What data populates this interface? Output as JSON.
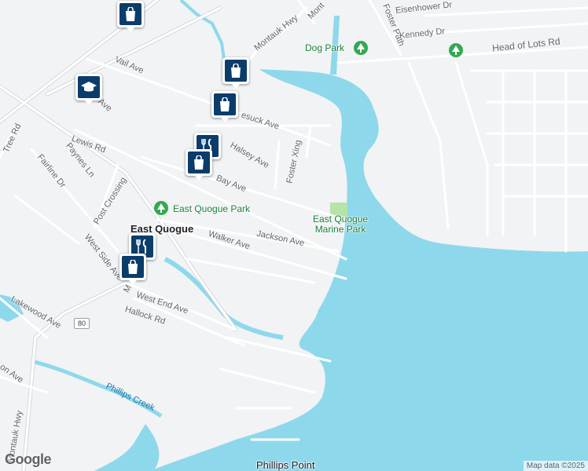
{
  "map": {
    "town": "East Quogue",
    "roads": {
      "montauk_hwy_top": "Montauk Hwy",
      "montauk_hwy_left": "Montauk Hwy",
      "mont_top": "Mont",
      "vail": "Vail Ave",
      "lewis": "Lewis Rd",
      "paynes": "Paynes Ln",
      "fairline": "Fairline Dr",
      "tree_rd": "Tree Rd",
      "post_crossing": "Post Crossing",
      "west_side": "West Side Ave",
      "lakewood": "Lakewood Ave",
      "on_ave": "on Ave",
      "bay": "Bay Ave",
      "halsey": "Halsey Ave",
      "foster_xing": "Foster Xing",
      "esuck": "esuck Ave",
      "walker": "Walker Ave",
      "jackson": "Jackson Ave",
      "west_end": "West End Ave",
      "hallock": "Hallock Rd",
      "main_fragment": "M",
      "foster_path": "Foster Path",
      "eisenhower": "Eisenhower Dr",
      "kennedy": "Kennedy Dr",
      "head_of_lots": "Head of Lots Rd",
      "ave_fragment": "Ave",
      "route_shield": "80"
    },
    "places": {
      "dog_park": "Dog Park",
      "eq_park": "East Quogue Park",
      "marine_park_line1": "East Quogue",
      "marine_park_line2": "Marine Park"
    },
    "water": {
      "phillips_creek": "Phillips Creek",
      "phillips_point": "Phillips Point"
    },
    "pins": [
      {
        "kind": "shopping-bag-icon"
      },
      {
        "kind": "graduation-cap-icon"
      },
      {
        "kind": "shopping-bag-icon"
      },
      {
        "kind": "shopping-bag-icon"
      },
      {
        "kind": "restaurant-icon"
      },
      {
        "kind": "shopping-bag-icon"
      },
      {
        "kind": "restaurant-icon"
      },
      {
        "kind": "shopping-bag-icon"
      }
    ],
    "logo": "Google",
    "attribution": "Map data ©2025"
  },
  "colors": {
    "land": "#f1f3f4",
    "water": "#8ed8ec",
    "road": "#ffffff",
    "road_casing": "#d5d9dd",
    "park_green": "#34a853",
    "pin_navy": "#0b3d6b"
  }
}
